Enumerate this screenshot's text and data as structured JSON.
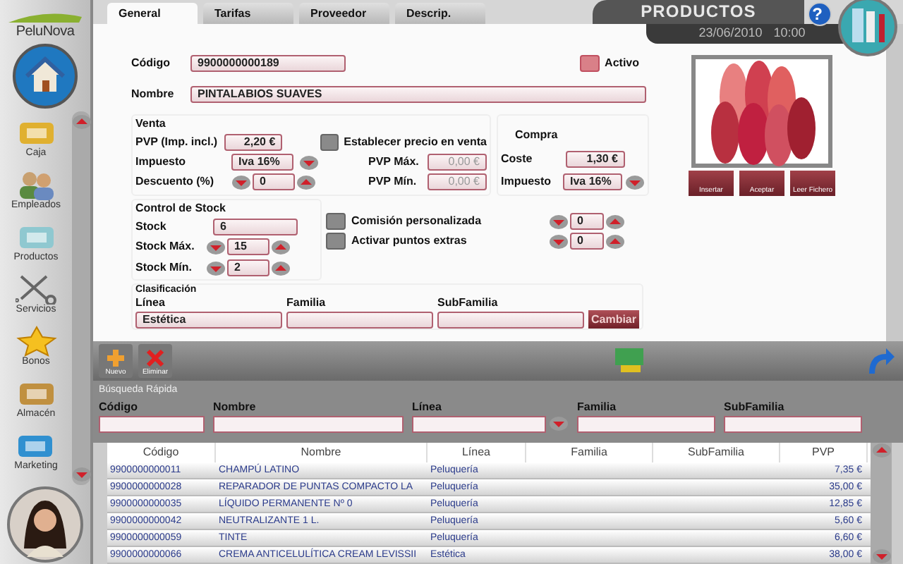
{
  "sidebar": {
    "logo": "PeluNova",
    "items": [
      {
        "label": "Caja"
      },
      {
        "label": "Empleados"
      },
      {
        "label": "Productos"
      },
      {
        "label": "Servicios"
      },
      {
        "label": "Bonos"
      },
      {
        "label": "Almacén"
      },
      {
        "label": "Marketing"
      }
    ]
  },
  "tabs": [
    {
      "label": "General",
      "selected": true
    },
    {
      "label": "Tarifas",
      "selected": false
    },
    {
      "label": "Proveedor",
      "selected": false
    },
    {
      "label": "Descrip.",
      "selected": false
    }
  ],
  "header": {
    "title": "PRODUCTOS",
    "date": "23/06/2010",
    "time": "10:00",
    "help": "?"
  },
  "form": {
    "codigo": {
      "label": "Código",
      "value": "9900000000189"
    },
    "activo": {
      "label": "Activo",
      "checked": true
    },
    "nombre": {
      "label": "Nombre",
      "value": "PINTALABIOS SUAVES"
    },
    "venta": {
      "title": "Venta",
      "pvp": {
        "label": "PVP  (Imp. incl.)",
        "value": "2,20 €"
      },
      "establecer": {
        "label": "Establecer precio en venta",
        "checked": false
      },
      "impuesto": {
        "label": "Impuesto",
        "value": "Iva 16%"
      },
      "pvp_max": {
        "label": "PVP Máx.",
        "value": "0,00 €"
      },
      "descuento": {
        "label": "Descuento (%)",
        "value": "0"
      },
      "pvp_min": {
        "label": "PVP Mín.",
        "value": "0,00 €"
      }
    },
    "compra": {
      "title": "Compra",
      "coste": {
        "label": "Coste",
        "value": "1,30 €"
      },
      "impuesto": {
        "label": "Impuesto",
        "value": "Iva 16%"
      }
    },
    "image_buttons": [
      "Insertar",
      "Aceptar",
      "Leer Fichero"
    ],
    "stock": {
      "title": "Control de Stock",
      "stock": {
        "label": "Stock",
        "value": "6"
      },
      "max": {
        "label": "Stock Máx.",
        "value": "15"
      },
      "min": {
        "label": "Stock Mín.",
        "value": "2"
      }
    },
    "options": [
      {
        "label": "Comisión personalizada",
        "checked": false,
        "value": "0"
      },
      {
        "label": "Activar puntos extras",
        "checked": false,
        "value": "0"
      }
    ],
    "clasificacion": {
      "title": "Clasificación",
      "linea": {
        "label": "Línea",
        "value": "Estética"
      },
      "familia": {
        "label": "Familia"
      },
      "subfamilia": {
        "label": "SubFamilia"
      },
      "button": "Cambiar"
    }
  },
  "toolbar": [
    "Nuevo",
    "Eliminar"
  ],
  "search": {
    "title": "Búsqueda Rápida",
    "fields": [
      "Código",
      "Nombre",
      "Línea",
      "Familia",
      "SubFamilia"
    ]
  },
  "table": {
    "columns": [
      "Código",
      "Nombre",
      "Línea",
      "Familia",
      "SubFamilia",
      "PVP"
    ],
    "rows": [
      {
        "codigo": "9900000000011",
        "nombre": "CHAMPÚ LATINO",
        "linea": "Peluquería",
        "pvp": "7,35 €"
      },
      {
        "codigo": "9900000000028",
        "nombre": "REPARADOR DE PUNTAS COMPACTO LA",
        "linea": "Peluquería",
        "pvp": "35,00 €"
      },
      {
        "codigo": "9900000000035",
        "nombre": "LÍQUIDO PERMANENTE Nº 0",
        "linea": "Peluquería",
        "pvp": "12,85 €"
      },
      {
        "codigo": "9900000000042",
        "nombre": "NEUTRALIZANTE 1 L.",
        "linea": "Peluquería",
        "pvp": "5,60 €"
      },
      {
        "codigo": "9900000000059",
        "nombre": "TINTE",
        "linea": "Peluquería",
        "pvp": "6,60 €"
      },
      {
        "codigo": "9900000000066",
        "nombre": "CREMA ANTICELULÍTICA CREAM LEVISSII",
        "linea": "Estética",
        "pvp": "38,00 €"
      }
    ]
  }
}
